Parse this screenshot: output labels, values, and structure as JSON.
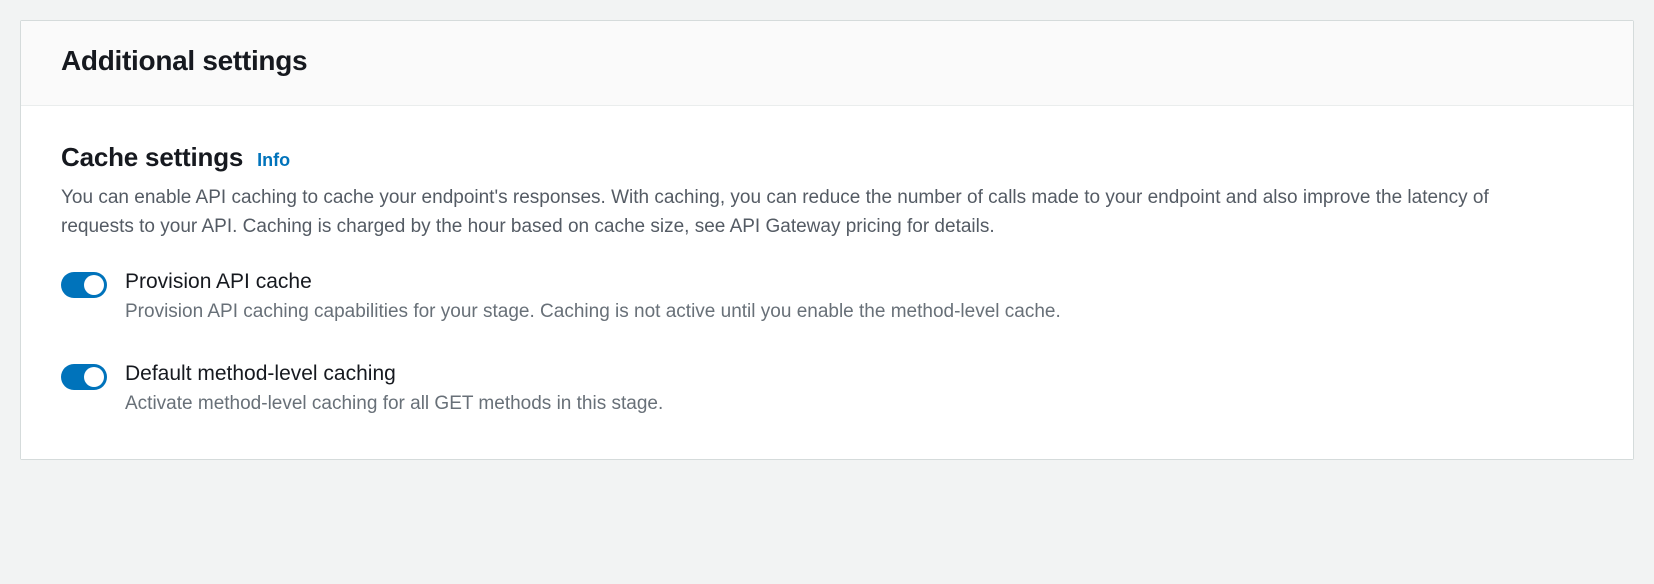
{
  "panel": {
    "title": "Additional settings"
  },
  "cache": {
    "title": "Cache settings",
    "info_label": "Info",
    "description": "You can enable API caching to cache your endpoint's responses. With caching, you can reduce the number of calls made to your endpoint and also improve the latency of requests to your API. Caching is charged by the hour based on cache size, see API Gateway pricing for details.",
    "toggles": [
      {
        "label": "Provision API cache",
        "description": "Provision API caching capabilities for your stage. Caching is not active until you enable the method-level cache.",
        "enabled": true
      },
      {
        "label": "Default method-level caching",
        "description": "Activate method-level caching for all GET methods in this stage.",
        "enabled": true
      }
    ]
  }
}
